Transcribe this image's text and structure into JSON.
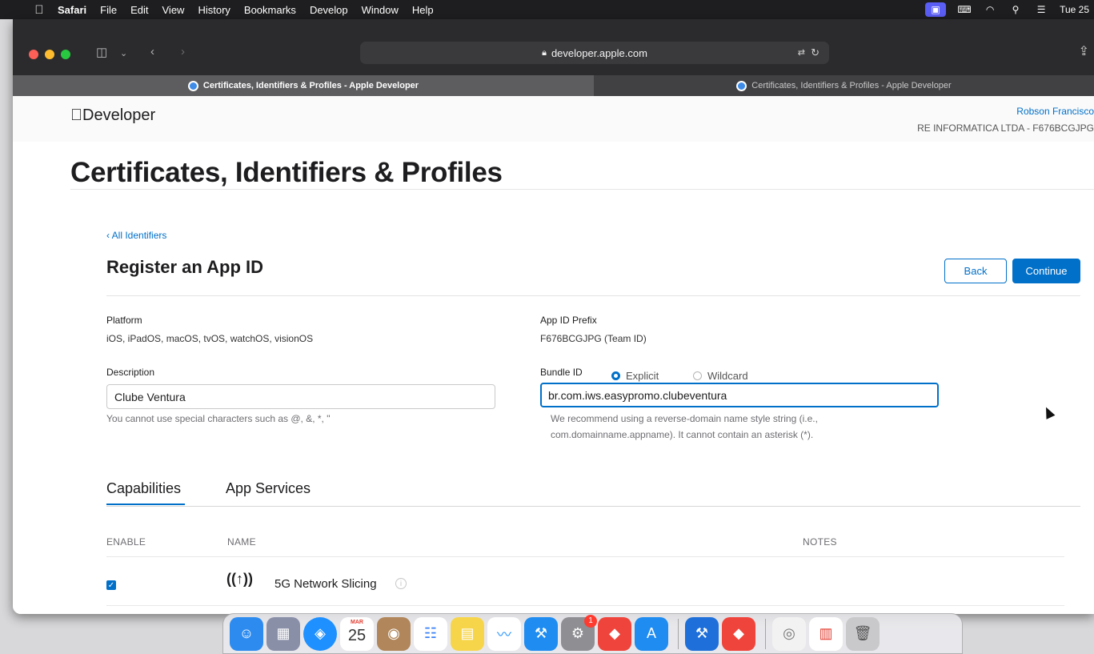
{
  "menubar": {
    "apple_icon": "",
    "app_name": "Safari",
    "items": [
      "File",
      "Edit",
      "View",
      "History",
      "Bookmarks",
      "Develop",
      "Window",
      "Help"
    ],
    "clock": "Tue 25"
  },
  "browser": {
    "url": "developer.apple.com",
    "tabs": [
      {
        "title": "Certificates, Identifiers & Profiles - Apple Developer",
        "active": true
      },
      {
        "title": "Certificates, Identifiers & Profiles - Apple Developer",
        "active": false
      }
    ]
  },
  "header": {
    "logo": "Developer",
    "account_name": "Robson Francisco",
    "account_org": "RE INFORMATICA LTDA - F676BCGJPG"
  },
  "page": {
    "title": "Certificates, Identifiers & Profiles",
    "back_link": "‹ All Identifiers",
    "register_title": "Register an App ID",
    "back_button": "Back",
    "continue_button": "Continue"
  },
  "form": {
    "platform_label": "Platform",
    "platform_value": "iOS, iPadOS, macOS, tvOS, watchOS, visionOS",
    "prefix_label": "App ID Prefix",
    "prefix_value": "F676BCGJPG (Team ID)",
    "description_label": "Description",
    "description_value": "Clube Ventura",
    "description_help": "You cannot use special characters such as @, &, *, \"",
    "bundle_label": "Bundle ID",
    "bundle_option_explicit": "Explicit",
    "bundle_option_wildcard": "Wildcard",
    "bundle_selected": "Explicit",
    "bundle_value": "br.com.iws.easypromo.clubeventura",
    "bundle_help_line1": "We recommend using a reverse-domain name style string (i.e.,",
    "bundle_help_line2": "com.domainname.appname). It cannot contain an asterisk (*)."
  },
  "capabilities": {
    "tabs": [
      "Capabilities",
      "App Services"
    ],
    "active_tab": "Capabilities",
    "columns": [
      "ENABLE",
      "NAME",
      "NOTES"
    ],
    "rows": [
      {
        "enabled": true,
        "icon": "antenna-icon",
        "name": "5G Network Slicing"
      }
    ]
  },
  "dock": {
    "apps": [
      "Finder",
      "Launchpad",
      "Safari",
      "Calendar",
      "Contacts",
      "Reminders",
      "Notes",
      "Freeform",
      "Xcode Instruments",
      "System Settings",
      "AnyDesk",
      "App Store",
      "Xcode",
      "Transporter",
      "Preview",
      "Documents",
      "Trash"
    ],
    "calendar_month": "MAR",
    "calendar_day": "25",
    "settings_badge": "1"
  },
  "colors": {
    "accent": "#0070c9",
    "menubar_bg": "#1e1e20",
    "toolbar_bg": "#2b2b2d"
  }
}
